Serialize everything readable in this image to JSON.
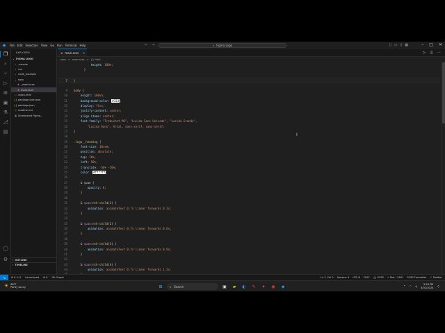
{
  "titlebar": {
    "menu": [
      "File",
      "Edit",
      "Selection",
      "View",
      "Go",
      "Run",
      "Terminal",
      "Help"
    ],
    "search": "Figma Logo"
  },
  "sidebar": {
    "header": "EXPLORER",
    "project": "FIGMA LOGO",
    "items": [
      {
        "label": ".vscode",
        "icon": "chevron-right-icon",
        "indent": 1
      },
      {
        "label": "css",
        "icon": "chevron-right-icon",
        "indent": 1
      },
      {
        "label": "node_modules",
        "icon": "chevron-right-icon",
        "indent": 1
      },
      {
        "label": "sass",
        "icon": "chevron-down-icon",
        "indent": 1
      },
      {
        "label": "_reset.scss",
        "icon": "sass-icon",
        "indent": 2
      },
      {
        "label": "main.scss",
        "icon": "sass-icon",
        "indent": 2
      },
      {
        "label": "index.html",
        "icon": "html-icon",
        "indent": 1
      },
      {
        "label": "package-lock.json",
        "icon": "json-icon",
        "indent": 1
      },
      {
        "label": "package.json",
        "icon": "json-icon",
        "indent": 1
      },
      {
        "label": "readme.md",
        "icon": "markdown-icon",
        "indent": 1
      },
      {
        "label": "Screenshot Figma...",
        "icon": "image-icon",
        "indent": 1
      }
    ],
    "outline": "OUTLINE",
    "timeline": "TIMELINE"
  },
  "editor": {
    "tab": "main.scss",
    "breadcrumb": [
      "sass",
      ">",
      "main.scss",
      ">",
      "{} html"
    ],
    "lines": [
      {
        "n": "",
        "t": "          height: 100%;"
      },
      {
        "n": "",
        "t": "      }"
      },
      {
        "n": "",
        "t": ""
      },
      {
        "n": "7",
        "t": "}",
        "cur": true
      },
      {
        "n": "",
        "t": ""
      },
      {
        "n": "9",
        "t": "body {"
      },
      {
        "n": "10",
        "t": "    height: 100vh;"
      },
      {
        "n": "11",
        "t": "    background-color: #333;"
      },
      {
        "n": "12",
        "t": "    display: flex;"
      },
      {
        "n": "13",
        "t": "    justify-content: center;"
      },
      {
        "n": "14",
        "t": "    align-items: center;"
      },
      {
        "n": "15",
        "t": "    font-family: \"Trebuchet MS\", \"Lucida Sans Unicode\", \"Lucida Grande\","
      },
      {
        "n": "16",
        "t": "        \"Lucida Sans\", Arial, sans-serif, sans-serif;"
      },
      {
        "n": "17",
        "t": "}"
      },
      {
        "n": "18",
        "t": ""
      },
      {
        "n": "19",
        "t": ".logo__heading {"
      },
      {
        "n": "20",
        "t": "    font-size: 10rem;"
      },
      {
        "n": "21",
        "t": "    position: absolute;"
      },
      {
        "n": "22",
        "t": "    top: 10%;"
      },
      {
        "n": "23",
        "t": "    left: 50%;"
      },
      {
        "n": "24",
        "t": "    translate: -50% -50%;"
      },
      {
        "n": "25",
        "t": "    color: #ffffff;"
      },
      {
        "n": "26",
        "t": ""
      },
      {
        "n": "27",
        "t": "    & span {"
      },
      {
        "n": "28",
        "t": "        opacity: 0;"
      },
      {
        "n": "29",
        "t": "    }"
      },
      {
        "n": "30",
        "t": ""
      },
      {
        "n": "31",
        "t": "    & span:nth-child(1) {"
      },
      {
        "n": "32",
        "t": "        animation: animateText 0.7s linear forwards 0.3s;"
      },
      {
        "n": "33",
        "t": "    }"
      },
      {
        "n": "34",
        "t": ""
      },
      {
        "n": "35",
        "t": "    & span:nth-child(2) {"
      },
      {
        "n": "36",
        "t": "        animation: animateText 0.7s linear forwards 0.6s;"
      },
      {
        "n": "37",
        "t": "    }"
      },
      {
        "n": "38",
        "t": ""
      },
      {
        "n": "39",
        "t": "    & span:nth-child(3) {"
      },
      {
        "n": "40",
        "t": "        animation: animateText 0.7s linear forwards 0.9s;"
      },
      {
        "n": "41",
        "t": "    }"
      },
      {
        "n": "42",
        "t": ""
      },
      {
        "n": "43",
        "t": "    & span:nth-child(4) {"
      },
      {
        "n": "44",
        "t": "        animation: animateText 0.7s linear forwards 1.2s;"
      },
      {
        "n": "45",
        "t": "    }"
      },
      {
        "n": "46",
        "t": "}"
      }
    ]
  },
  "statusbar": {
    "left": [
      "⊗ 0 ⚠ 0",
      "Launchpad",
      "⊗ 0",
      "Git Graph"
    ],
    "right": [
      "Ln 7, Col 2",
      "Spaces: 4",
      "UTF-8",
      "CRLF",
      "{} SCSS",
      "⚡ Port : 5501",
      "SCSS Formatter",
      "✓ Prettier"
    ]
  },
  "taskbar": {
    "temp": "66°F",
    "weather": "Partly sunny",
    "search_placeholder": "Search",
    "time": "3:34 PM",
    "date": "3/31/2024",
    "misc": [
      "ENG"
    ]
  },
  "colors": {
    "accent": "#0078d4",
    "editor_bg": "#1f1f1f",
    "sidebar_bg": "#181818",
    "selector": "#d7ba7d",
    "property": "#9cdcfe",
    "value": "#ce9178",
    "keyword": "#c586c0"
  }
}
